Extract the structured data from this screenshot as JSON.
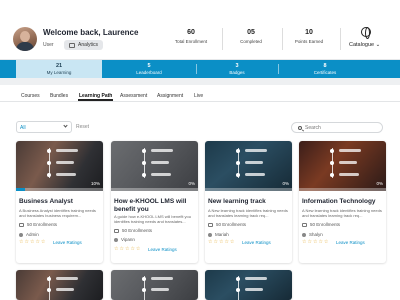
{
  "header": {
    "welcome": "Welcome back, Laurence",
    "role": "User",
    "analytics_label": "Analytics",
    "stats": [
      {
        "value": "60",
        "label": "Total Enrollment"
      },
      {
        "value": "05",
        "label": "Completed"
      },
      {
        "value": "10",
        "label": "Points Earned"
      }
    ],
    "catalogue_label": "Catalogue ⌄"
  },
  "status_bar": [
    {
      "count": "21",
      "label": "My Learning"
    },
    {
      "count": "5",
      "label": "Leaderboard"
    },
    {
      "count": "3",
      "label": "Badges"
    },
    {
      "count": "8",
      "label": "Certificates"
    }
  ],
  "tabs": [
    "Courses",
    "Bundles",
    "Learning Path",
    "Assessment",
    "Assignment",
    "Live"
  ],
  "active_tab": "Learning Path",
  "filter": {
    "selected": "All",
    "reset_label": "Reset"
  },
  "search": {
    "placeholder": "Search"
  },
  "cards": [
    {
      "title": "Business Analyst",
      "description": "A Business Analyst identifies training needs and translates business requirem...",
      "enrollments": "50 Enrollments",
      "author": "Admin",
      "progress_label": "10%",
      "progress": 0.1,
      "stars": "☆☆☆☆☆",
      "leave": "Leave Ratings"
    },
    {
      "title": "How e-KHOOL LMS will benefit you",
      "description": "A guide how e-KHOOL LMS will benefit you identifies training needs and translates...",
      "enrollments": "50 Enrollments",
      "author": "Vipann",
      "progress_label": "0%",
      "progress": 0,
      "stars": "☆☆☆☆☆",
      "leave": "Leave Ratings"
    },
    {
      "title": "New learning track",
      "description": "A New learning track identifies training needs and translates learning track req...",
      "enrollments": "50 Enrollments",
      "author": "Mariah",
      "progress_label": "0%",
      "progress": 0,
      "stars": "☆☆☆☆☆",
      "leave": "Leave Ratings"
    },
    {
      "title": "Information Technology",
      "description": "A New learning track identifies training needs and translates learning track req...",
      "enrollments": "50 Enrollments",
      "author": "Shalyn",
      "progress_label": "0%",
      "progress": 0,
      "stars": "☆☆☆☆☆",
      "leave": "Leave Ratings"
    }
  ],
  "colors": {
    "accent": "#0b8fc6",
    "active_tab_bg": "#c9e6f3",
    "star": "#e0a21a"
  }
}
